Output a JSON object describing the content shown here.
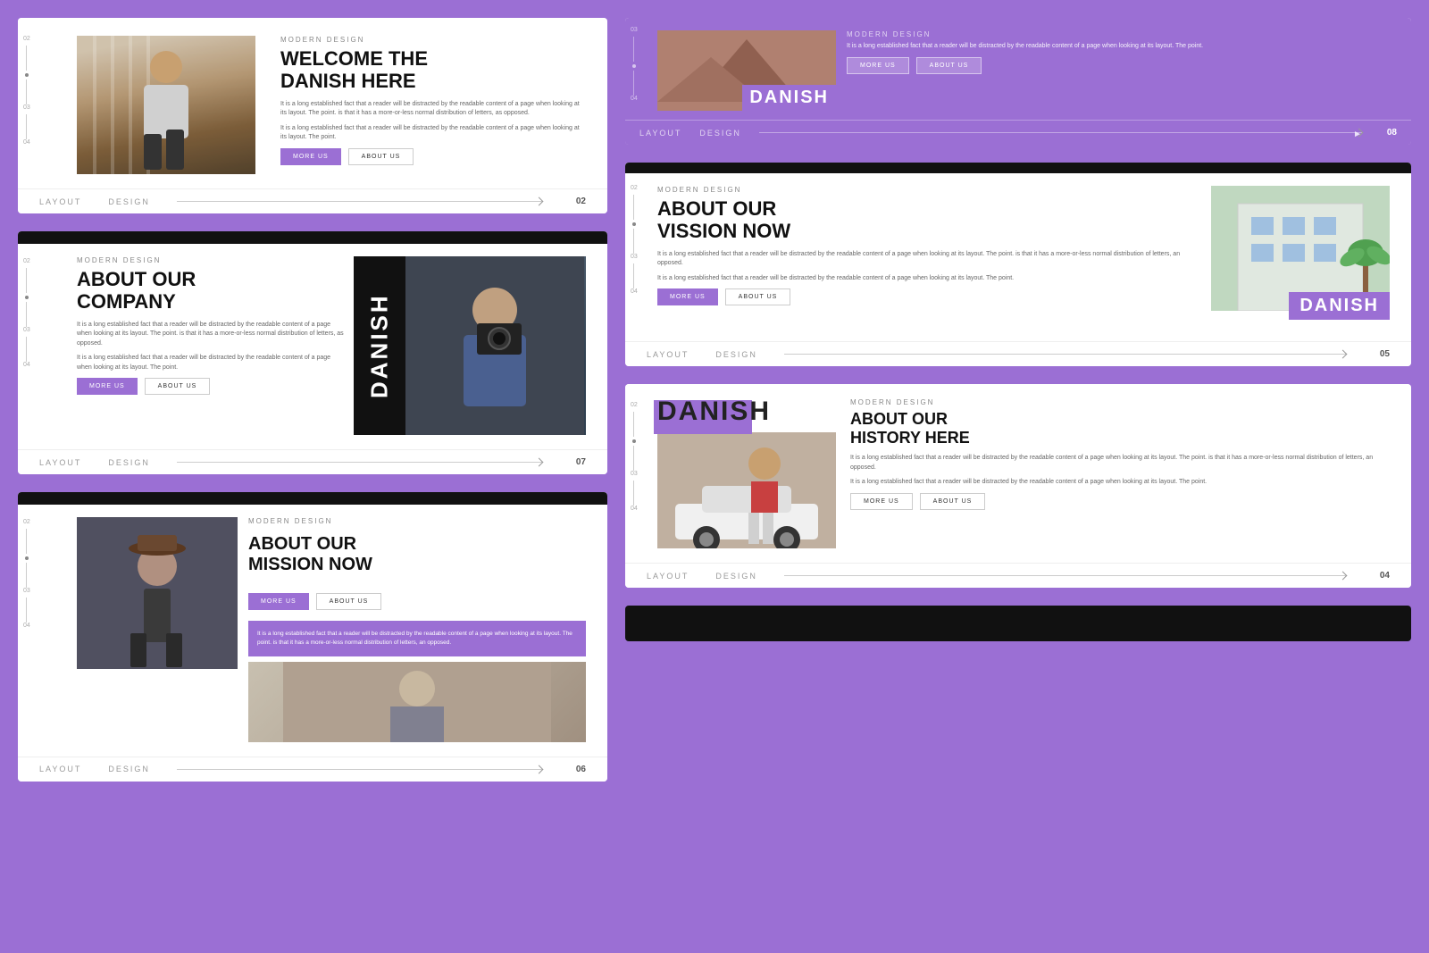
{
  "slides": {
    "s1": {
      "label": "MODERN DESIGN",
      "title": "WELCOME THE\nDANISH HERE",
      "body1": "It is a long established fact that a reader will be distracted by the readable content of a page when looking at its layout. The point. is that it has a more-or-less normal distribution of letters, as opposed.",
      "body2": "It is a long established fact that a reader will be distracted by the readable content of a page when looking at its layout. The point.",
      "btn1": "MORE US",
      "btn2": "ABOUT US",
      "footer_layout": "LAYOUT",
      "footer_design": "DESIGN",
      "footer_num": "02",
      "side_nums": [
        "02",
        "03",
        "04"
      ]
    },
    "s2": {
      "label": "MODERN DESIGN",
      "title": "ABOUT OUR\nCOMPANY",
      "body1": "It is a long established fact that a reader will be distracted by the readable content of a page when looking at its layout. The point. is that it has a more-or-less normal distribution of letters, as opposed.",
      "body2": "It is a long established fact that a reader will be distracted by the readable content of a page when looking at its layout. The point.",
      "btn1": "MORE US",
      "btn2": "ABOUT US",
      "danish_text": "DANISH",
      "footer_layout": "LAYOUT",
      "footer_design": "DESIGN",
      "footer_num": "07",
      "side_nums": [
        "02",
        "03",
        "04"
      ]
    },
    "s3": {
      "label": "MODERN DESIGN",
      "title": "ABOUT OUR\nMISSION NOW",
      "body1": "It is a long established fact that a reader will be distracted by the readable content of a page when looking at its layout. The point. is that it has a more-or-less normal distribution of letters, an opposed.",
      "purple_text": "It is a long established fact that a reader will be distracted by the readable content of a page when looking at its layout. The point. is that it has a more-or-less normal distribution of letters, an opposed.",
      "btn1": "MORE US",
      "btn2": "ABOUT US",
      "footer_layout": "LAYOUT",
      "footer_design": "DESIGN",
      "footer_num": "06",
      "side_nums": [
        "02",
        "03",
        "04"
      ]
    },
    "r1": {
      "label": "MODERN DESIGN",
      "danish_text": "DANISH",
      "body1": "It is a long established fact that a reader will be distracted by the readable content of a page when looking at its layout. The point.",
      "btn1": "MORE US",
      "btn2": "ABOUT US",
      "footer_layout": "LAYOUT",
      "footer_design": "DESIGN",
      "footer_num": "08",
      "side_nums": [
        "03",
        "04"
      ]
    },
    "r2": {
      "label": "MODERN DESIGN",
      "title": "ABOUT OUR\nVISSION NOW",
      "body1": "It is a long established fact that a reader will be distracted by the readable content of a page when looking at its layout. The point. is that it has a more-or-less normal distribution of letters, an opposed.",
      "body2": "It is a long established fact that a reader will be distracted by the readable content of a page when looking at its layout. The point.",
      "btn1": "MORE US",
      "btn2": "ABOUT US",
      "danish_text": "DANISH",
      "footer_layout": "LAYOUT",
      "footer_design": "DESIGN",
      "footer_num": "05",
      "side_nums": [
        "02",
        "03",
        "04"
      ]
    },
    "r3": {
      "label": "MODERN DESIGN",
      "title": "ABOUT OUR\nHISTORY HERE",
      "danish_text": "DANISH",
      "body1": "It is a long established fact that a reader will be distracted by the readable content of a page when looking at its layout. The point. is that it has a more-or-less normal distribution of letters, an opposed.",
      "body2": "It is a long established fact that a reader will be distracted by the readable content of a page when looking at its layout. The point.",
      "btn1": "MORE US",
      "btn2": "ABOUT US",
      "footer_layout": "LAYOUT",
      "footer_design": "DESIGN",
      "footer_num": "04",
      "side_nums": [
        "02",
        "03",
        "04"
      ]
    }
  },
  "colors": {
    "purple": "#9b6fd4",
    "black": "#111111",
    "white": "#ffffff"
  }
}
